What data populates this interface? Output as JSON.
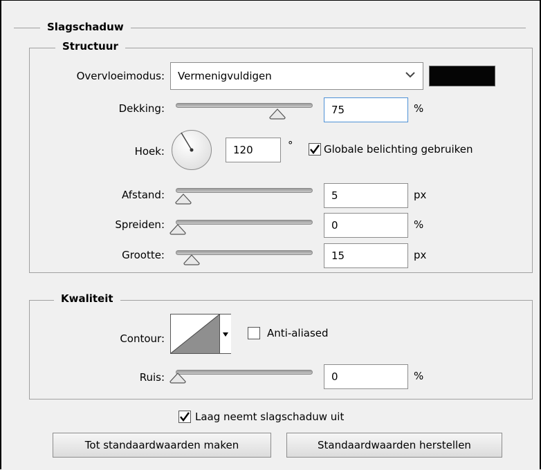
{
  "section_title": "Slagschaduw",
  "structure": {
    "title": "Structuur",
    "blend_mode": {
      "label": "Overvloeimodus:",
      "value": "Vermenigvuldigen",
      "color": "#050505"
    },
    "opacity": {
      "label": "Dekking:",
      "value": "75",
      "unit": "%",
      "fraction": 0.75
    },
    "angle": {
      "label": "Hoek:",
      "value": "120",
      "unit": "°",
      "global_light_label": "Globale belichting gebruiken",
      "global_light_checked": true
    },
    "distance": {
      "label": "Afstand:",
      "value": "5",
      "unit": "px"
    },
    "spread": {
      "label": "Spreiden:",
      "value": "0",
      "unit": "%"
    },
    "size": {
      "label": "Grootte:",
      "value": "15",
      "unit": "px"
    }
  },
  "quality": {
    "title": "Kwaliteit",
    "contour": {
      "label": "Contour:",
      "antialiased_label": "Anti-aliased",
      "antialiased_checked": false
    },
    "noise": {
      "label": "Ruis:",
      "value": "0",
      "unit": "%"
    }
  },
  "knockout": {
    "label": "Laag neemt slagschaduw uit",
    "checked": true
  },
  "buttons": {
    "make_default": "Tot standaardwaarden maken",
    "reset_default": "Standaardwaarden herstellen"
  }
}
